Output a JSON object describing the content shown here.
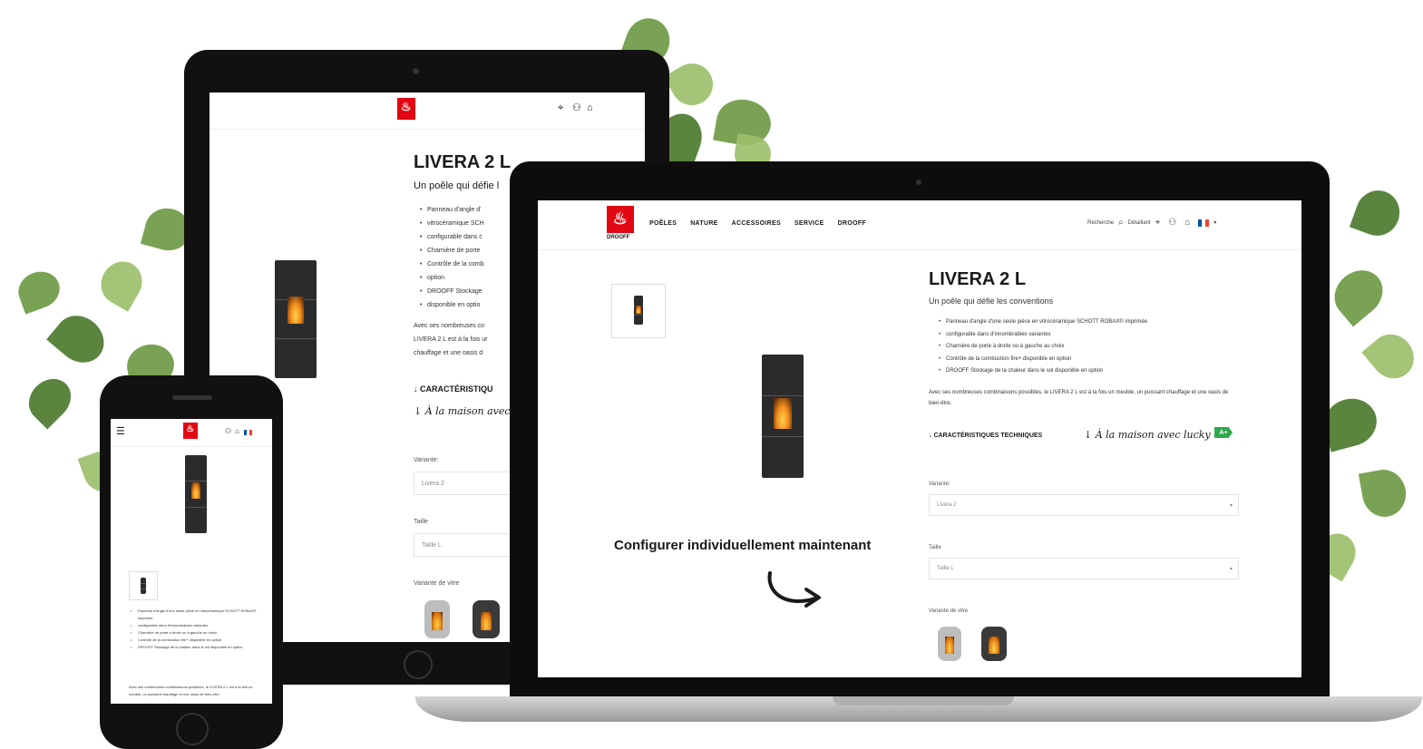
{
  "brand": {
    "name": "DROOFF",
    "accent": "#e30613"
  },
  "nav": {
    "items": [
      "POÊLES",
      "NATURE",
      "ACCESSOIRES",
      "SERVICE",
      "DROOFF"
    ],
    "search_label": "Recherche",
    "dealer_label": "Détaillant"
  },
  "icons": [
    "search-icon",
    "location-pin-icon",
    "user-icon",
    "shopping-bag-icon",
    "french-flag-icon",
    "chevron-down-icon",
    "menu-icon"
  ],
  "product": {
    "title": "LIVERA 2 L",
    "subtitle": "Un poêle qui défie les conventions",
    "features": [
      "Panneau d'angle d'une seule pièce en vitrocéramique SCHOTT ROBAX® imprimée",
      "configurable dans d'innombrables variantes",
      "Charnière de porte à droite ou à gauche au choix",
      "Contrôle de la combustion fire+ disponible en option",
      "DROOFF Stockage de la chaleur dans le sol disponible en option"
    ],
    "description": "Avec ses nombreuses combinaisons possibles, le LIVERA 2 L est à la fois un meuble, un puissant chauffage et une oasis de bien-être.",
    "tech_link": "↓ CARACTÉRISTIQUES TECHNIQUES",
    "lucky_link": "↓ À la maison avec lucky",
    "energy_badge": "A+",
    "configure_text": "Configurer individuellement maintenant",
    "variant_label": "Variante:",
    "variant_value": "Livera 2",
    "size_label": "Taille",
    "size_value": "Taille L",
    "glass_label": "Variante de vitre"
  },
  "tablet": {
    "title": "LIVERA 2 L",
    "subtitle": "Un poêle qui défie l",
    "features": [
      "Panneau d'angle d'",
      "vitrocéramique SCH",
      "configurable dans c",
      "Charnière de porte",
      "Contrôle de la comb",
      "option",
      "DROOFF Stockage",
      "disponible en optio"
    ],
    "description_lines": [
      "Avec ses nombreuses co",
      "LIVERA 2 L est à la fois ur",
      "chauffage et une oasis d"
    ],
    "tech_link": "↓ CARACTÉRISTIQU",
    "lucky_link": "↓ À la maison avec lu",
    "variant_label": "Variante:",
    "variant_value": "Livera 2",
    "size_label": "Taille",
    "size_value": "Taille L",
    "glass_label": "Variante de vitre"
  },
  "phone": {
    "features": [
      "Panneau d'angle d'une seule pièce en vitrocéramique SCHOTT ROBAX® imprimée",
      "configurable dans d'innombrables variantes",
      "Charnière de porte à droite ou à gauche au choix",
      "Contrôle de la combustion fire+ disponible en option",
      "DROOFF Stockage de la chaleur dans le sol disponible en option"
    ],
    "description": "Avec ses nombreuses combinaisons possibles, le LIVERA 2 L est à la fois un meuble, un puissant chauffage et une oasis de bien-être."
  }
}
